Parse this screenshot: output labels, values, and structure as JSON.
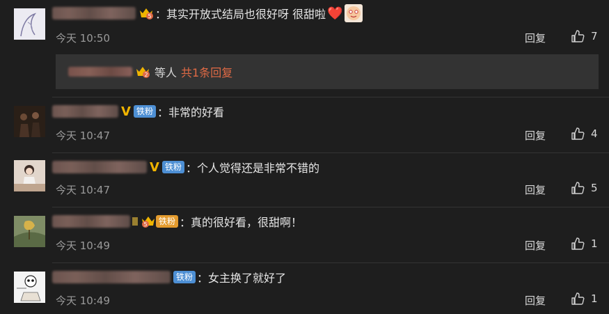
{
  "comments": [
    {
      "text": "：其实开放式结局也很好呀 很甜啦",
      "emoji_heart": "❤️",
      "time": "今天 10:50",
      "reply_label": "回复",
      "likes": "7",
      "sub_reply": {
        "suffix": "等人",
        "link": "共1条回复"
      }
    },
    {
      "fan_badge": "铁粉",
      "text": "：非常的好看",
      "time": "今天 10:47",
      "reply_label": "回复",
      "likes": "4"
    },
    {
      "fan_badge": "铁粉",
      "text": "：个人觉得还是非常不错的",
      "time": "今天 10:47",
      "reply_label": "回复",
      "likes": "5"
    },
    {
      "fan_badge": "铁粉",
      "text": "：真的很好看，很甜啊！",
      "time": "今天 10:49",
      "reply_label": "回复",
      "likes": "1"
    },
    {
      "fan_badge": "铁粉",
      "text": "：女主换了就好了",
      "time": "今天 10:49",
      "reply_label": "回复",
      "likes": "1"
    }
  ],
  "colors": {
    "background": "#1e1e1e",
    "link": "#e06a45",
    "fan_badge": "#4d8fd4",
    "vip": "#f0b400"
  }
}
